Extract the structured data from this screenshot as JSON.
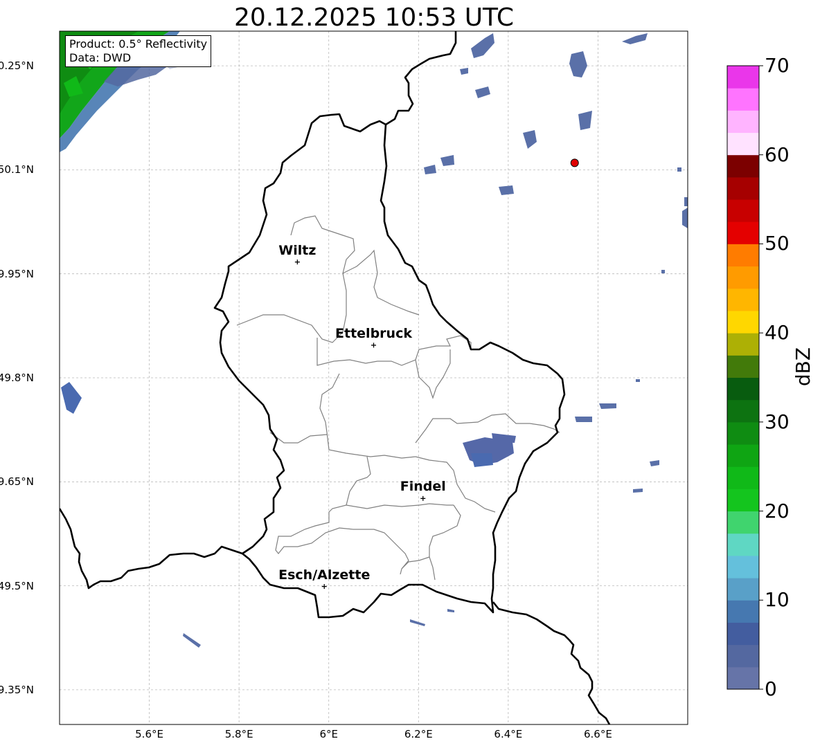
{
  "title": "20.12.2025 10:53 UTC",
  "info": {
    "product": "Product: 0.5° Reflectivity",
    "source": "Data: DWD"
  },
  "axes": {
    "lon_ticks": [
      {
        "value": 5.6,
        "label": "5.6°E"
      },
      {
        "value": 5.8,
        "label": "5.8°E"
      },
      {
        "value": 6.0,
        "label": "6°E"
      },
      {
        "value": 6.2,
        "label": "6.2°E"
      },
      {
        "value": 6.4,
        "label": "6.4°E"
      },
      {
        "value": 6.6,
        "label": "6.6°E"
      }
    ],
    "lat_ticks": [
      {
        "value": 50.25,
        "label": "50.25°N"
      },
      {
        "value": 50.1,
        "label": "50.1°N"
      },
      {
        "value": 49.95,
        "label": "49.95°N"
      },
      {
        "value": 49.8,
        "label": "49.8°N"
      },
      {
        "value": 49.65,
        "label": "49.65°N"
      },
      {
        "value": 49.5,
        "label": "49.5°N"
      },
      {
        "value": 49.35,
        "label": "49.35°N"
      }
    ],
    "lon_range": [
      5.4,
      6.8
    ],
    "lat_range": [
      49.3,
      50.3
    ]
  },
  "cities": [
    {
      "name": "Wiltz",
      "lon": 5.93,
      "lat": 49.967
    },
    {
      "name": "Ettelbruck",
      "lon": 6.1,
      "lat": 49.847
    },
    {
      "name": "Findel",
      "lon": 6.21,
      "lat": 49.626
    },
    {
      "name": "Esch/Alzette",
      "lon": 5.99,
      "lat": 49.499
    }
  ],
  "radar_site": {
    "lon": 6.548,
    "lat": 50.11,
    "color": "#e00000"
  },
  "colorbar": {
    "label": "dBZ",
    "min": 0,
    "max": 70,
    "step": 2.5,
    "tick_labels": [
      "0",
      "10",
      "20",
      "30",
      "40",
      "50",
      "60",
      "70"
    ],
    "colors": [
      "#6674a8",
      "#5468a0",
      "#435d9f",
      "#4678b0",
      "#59a0c8",
      "#64c0dc",
      "#5fd7c3",
      "#40d46e",
      "#14c51e",
      "#10b918",
      "#0fa513",
      "#0f8c12",
      "#0d7311",
      "#085c0f",
      "#427a0a",
      "#adb005",
      "#ffd700",
      "#ffb600",
      "#ff9b00",
      "#ff7c00",
      "#e40000",
      "#c80000",
      "#a60000",
      "#7c0000",
      "#ffe2ff",
      "#ffb4ff",
      "#ff74ff",
      "#ea36ea"
    ]
  },
  "colors": {
    "border": "#000000",
    "canton": "#808080",
    "grid": "#b8b8b8"
  }
}
